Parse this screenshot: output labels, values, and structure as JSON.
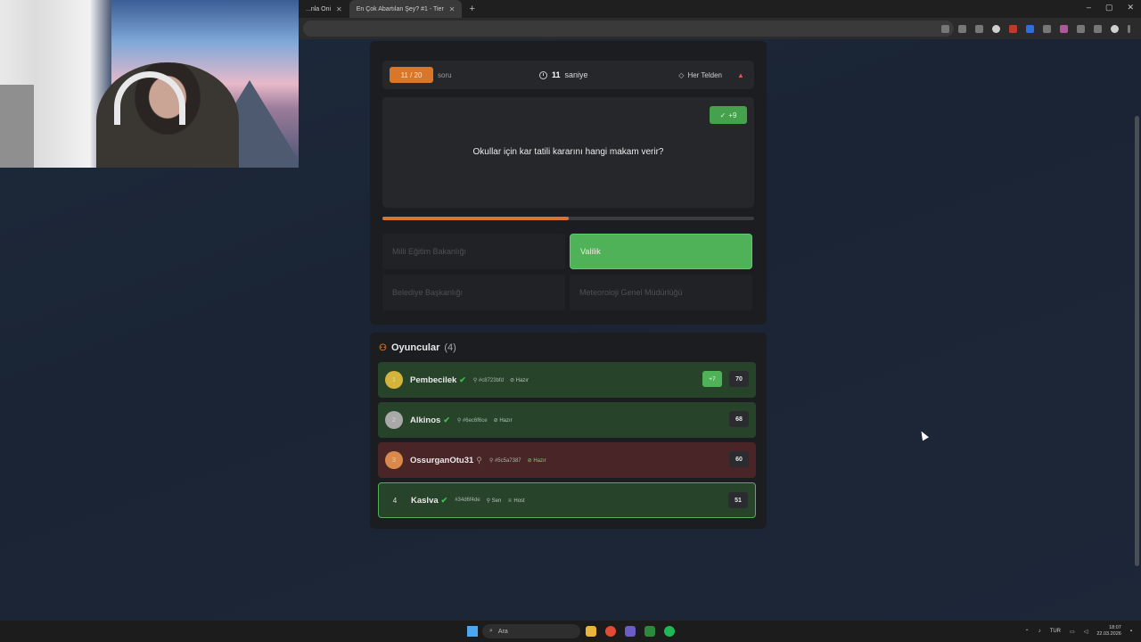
{
  "browser": {
    "tabs": [
      {
        "label": "...nla Oni",
        "active": false
      },
      {
        "label": "En Çok Abartılan Şey? #1 - Tier",
        "active": true
      }
    ],
    "new_tab": "+",
    "window_controls": [
      "–",
      "▢",
      "✕"
    ]
  },
  "game": {
    "question_counter": "11 / 20",
    "question_word": "soru",
    "timer_value": "11",
    "timer_unit": "saniye",
    "category": "Her Telden",
    "report_icon": "▲",
    "score_badge": "+9",
    "question": "Okullar için kar tatili kararını hangi makam verir?",
    "progress": 0.5,
    "answers": [
      {
        "label": "Milli Eğitim Bakanlığı",
        "correct": false
      },
      {
        "label": "Valilik",
        "correct": true
      },
      {
        "label": "Belediye Başkanlığı",
        "correct": false
      },
      {
        "label": "Meteoroloji Genel Müdürlüğü",
        "correct": false
      }
    ]
  },
  "players": {
    "title": "Oyuncular",
    "count": "(4)",
    "list": [
      {
        "rank": "1",
        "name": "Pembecilek",
        "mark": "✔",
        "meta": "#c8723bfd",
        "status": "Hazır",
        "gain": "+7",
        "score": "70",
        "style": "green",
        "rank_color": "#d4b43a"
      },
      {
        "rank": "2",
        "name": "Alkinos",
        "mark": "✔",
        "meta": "#6ec6f6ce",
        "status": "Hazır",
        "gain": "",
        "score": "68",
        "style": "green",
        "rank_color": "#a9a9a9"
      },
      {
        "rank": "3",
        "name": "OssurganOtu31",
        "mark": "",
        "meta": "#5c5a7387",
        "status": "Hazır",
        "gain": "",
        "score": "60",
        "style": "red",
        "rank_color": "#d98a4a"
      },
      {
        "rank": "4",
        "name": "Kaslva",
        "mark": "✔",
        "meta": "#34d6f4de",
        "status": "Sen",
        "extra": "Host",
        "gain": "",
        "score": "51",
        "style": "me",
        "rank_color": ""
      }
    ]
  },
  "taskbar": {
    "search": "Ara",
    "lang": "TUR",
    "time": "18:07",
    "date": "22.03.2026"
  }
}
